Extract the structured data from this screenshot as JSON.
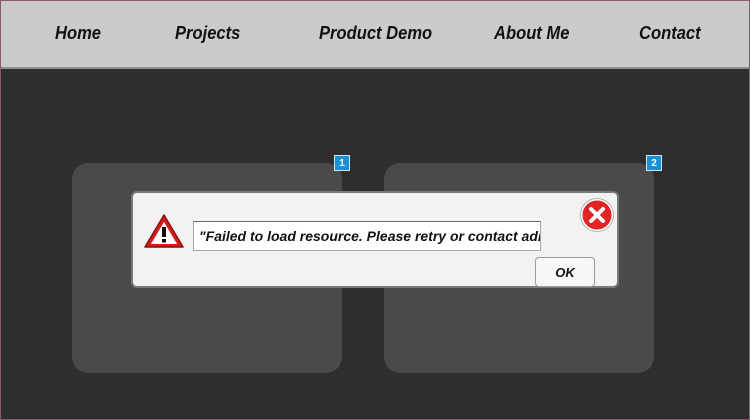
{
  "nav": {
    "items": [
      {
        "label": "Home"
      },
      {
        "label": "Projects"
      },
      {
        "label": "Product Demo"
      },
      {
        "label": "About Me"
      },
      {
        "label": "Contact"
      }
    ]
  },
  "panels": [
    {
      "badge": "1"
    },
    {
      "badge": "2"
    }
  ],
  "dialog": {
    "message": "\"Failed to load resource. Please retry or contact admin.\"",
    "ok_label": "OK",
    "warning_icon": "warning-triangle-icon",
    "close_icon": "close-circle-icon"
  },
  "colors": {
    "page_background": "#2e2e2e",
    "navbar_background": "#cbcbcb",
    "panel_background": "#4a4a4a",
    "badge_background": "#1a8fd6",
    "close_icon_red": "#e02424",
    "warning_icon_red": "#d41b1b"
  }
}
